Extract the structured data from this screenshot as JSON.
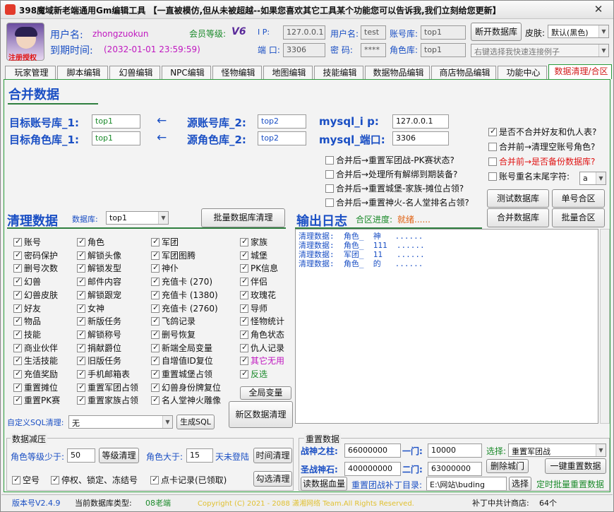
{
  "window": {
    "title": "398魔域新老端通用Gm编辑工具 【一直被模仿,但从未被超越--如果您喜欢其它工具某个功能您可以告诉我,我们立刻给您更新】",
    "close_icon": "close-icon"
  },
  "user": {
    "avatar_caption": "注册授权",
    "name_label": "用户名:",
    "name_value": "zhongzuokun",
    "expire_label": "到期时间:",
    "expire_value": "(2032-01-01 23:59:59)",
    "member_label": "会员等级:",
    "member_value": "V6"
  },
  "conn": {
    "ip_label": "I P:",
    "ip_value": "127.0.0.1",
    "user_label": "用户名:",
    "user_value": "test",
    "acct_db_label": "账号库:",
    "acct_db_value": "top1",
    "port_label": "端 口:",
    "port_value": "3306",
    "pwd_label": "密 码:",
    "pwd_value": "****",
    "role_db_label": "角色库:",
    "role_db_value": "top1",
    "disconnect_label": "断开数据库",
    "skin_label": "皮肤:",
    "skin_value": "默认(黑色)",
    "hint_value": "右键选择我快速连接例子"
  },
  "tabs": [
    "玩家管理",
    "脚本编辑",
    "幻兽编辑",
    "NPC编辑",
    "怪物编辑",
    "地图编辑",
    "技能编辑",
    "数据物品编辑",
    "商店物品编辑",
    "功能中心",
    "数据清理/合区"
  ],
  "merge": {
    "title": "合并数据",
    "target_acct_label": "目标账号库_1:",
    "target_acct_value": "top1",
    "target_role_label": "目标角色库_1:",
    "target_role_value": "top1",
    "arrow": "←",
    "src_acct_label": "源账号库_2:",
    "src_acct_value": "top2",
    "src_role_label": "源角色库_2:",
    "src_role_value": "top2",
    "mysql_ip_label": "mysql_i p:",
    "mysql_ip_value": "127.0.0.1",
    "mysql_port_label": "mysql_端口:",
    "mysql_port_value": "3306"
  },
  "merge_options": [
    {
      "label": "合并后→重置军团战-PK赛状态?",
      "checked": false
    },
    {
      "label": "合并后→处理所有解绑到期装备?",
      "checked": false
    },
    {
      "label": "合并后→重置城堡-家族-摊位占领?",
      "checked": false
    },
    {
      "label": "合并后→重置神火-名人堂排名占领?",
      "checked": false
    }
  ],
  "right_options": [
    {
      "label": "是否不合并好友和仇人表?",
      "checked": true,
      "color": "#111"
    },
    {
      "label": "合并前→清理空账号角色?",
      "checked": false,
      "color": "#111"
    },
    {
      "label": "合并前→是否备份数据库?",
      "checked": false,
      "color": "#e01414"
    },
    {
      "label": "账号重名末尾字符:",
      "checked": false,
      "color": "#111"
    }
  ],
  "suffix_value": "a",
  "merge_buttons": {
    "test_db": "测试数据库",
    "single": "单号合区",
    "merge_db": "合并数据库",
    "batch": "批量合区"
  },
  "clean": {
    "title": "清理数据",
    "db_label": "数据库:",
    "db_value": "top1",
    "batch_clean": "批量数据库清理"
  },
  "log": {
    "title": "输出日志",
    "progress_label": "合区进度:",
    "progress_value": "就绪......",
    "lines": [
      "清理数据:  角色_  神   ......",
      "清理数据:  角色_  111  ......",
      "清理数据:  军团_  11   ......",
      "清理数据:  角色_  的   ......"
    ]
  },
  "clean_col1": [
    {
      "label": "账号",
      "checked": true
    },
    {
      "label": "密码保护",
      "checked": true
    },
    {
      "label": "删号次数",
      "checked": true
    },
    {
      "label": "幻兽",
      "checked": true
    },
    {
      "label": "幻兽皮肤",
      "checked": true
    },
    {
      "label": "好友",
      "checked": true
    },
    {
      "label": "物品",
      "checked": true
    },
    {
      "label": "技能",
      "checked": true
    },
    {
      "label": "商业伙伴",
      "checked": true
    },
    {
      "label": "生活技能",
      "checked": true
    },
    {
      "label": "充值奖励",
      "checked": true
    },
    {
      "label": "重置摊位",
      "checked": true
    },
    {
      "label": "重置PK赛",
      "checked": true
    }
  ],
  "clean_col2": [
    {
      "label": "角色",
      "checked": true
    },
    {
      "label": "解锁头像",
      "checked": true
    },
    {
      "label": "解锁发型",
      "checked": true
    },
    {
      "label": "邮件内容",
      "checked": true
    },
    {
      "label": "解锁跟宠",
      "checked": true
    },
    {
      "label": "女神",
      "checked": true
    },
    {
      "label": "新版任务",
      "checked": true
    },
    {
      "label": "解锁称号",
      "checked": true
    },
    {
      "label": "捐献爵位",
      "checked": true
    },
    {
      "label": "旧版任务",
      "checked": true
    },
    {
      "label": "手机邮箱表",
      "checked": true
    },
    {
      "label": "重置军团占领",
      "checked": true
    },
    {
      "label": "重置家族占领",
      "checked": true
    }
  ],
  "clean_col3": [
    {
      "label": "军团",
      "checked": true
    },
    {
      "label": "军团图腾",
      "checked": true
    },
    {
      "label": "神仆",
      "checked": true
    },
    {
      "label": "充值卡 (270)",
      "checked": true
    },
    {
      "label": "充值卡 (1380)",
      "checked": true
    },
    {
      "label": "充值卡 (2760)",
      "checked": true
    },
    {
      "label": "飞鸽记录",
      "checked": true
    },
    {
      "label": "删号恢复",
      "checked": true
    },
    {
      "label": "新端全局变量",
      "checked": true
    },
    {
      "label": "自增值ID复位",
      "checked": true
    },
    {
      "label": "重置城堡占领",
      "checked": true
    },
    {
      "label": "幻兽身份牌复位",
      "checked": true
    },
    {
      "label": "名人堂神火雕像",
      "checked": true
    }
  ],
  "clean_col4": [
    {
      "label": "家族",
      "checked": true,
      "color": "#111"
    },
    {
      "label": "城堡",
      "checked": true,
      "color": "#111"
    },
    {
      "label": "PK信息",
      "checked": true,
      "color": "#111"
    },
    {
      "label": "伴侣",
      "checked": true,
      "color": "#111"
    },
    {
      "label": "玫瑰花",
      "checked": true,
      "color": "#111"
    },
    {
      "label": "导师",
      "checked": true,
      "color": "#111"
    },
    {
      "label": "怪物统计",
      "checked": true,
      "color": "#111"
    },
    {
      "label": "角色状态",
      "checked": true,
      "color": "#111"
    },
    {
      "label": "仇人记录",
      "checked": true,
      "color": "#111"
    },
    {
      "label": "其它无用",
      "checked": true,
      "color": "#c018c0"
    },
    {
      "label": "反选",
      "checked": true,
      "color": "#1a8a2a"
    }
  ],
  "global_var": "全局变量",
  "new_zone_clean": "新区数据清理",
  "custom_sql": {
    "label": "自定义SQL清理:",
    "value": "无",
    "btn": "生成SQL"
  },
  "reduce": {
    "title": "数据减压",
    "level_label": "角色等级少于:",
    "level_value": "50",
    "level_btn": "等级清理",
    "days_label": "角色大于:",
    "days_value": "15",
    "days_unit": "天未登陆",
    "time_btn": "时间清理",
    "empty_label": "空号",
    "empty_checked": true,
    "ban_label": "停权、锁定、冻结号",
    "ban_checked": true,
    "card_label": "点卡记录(已领取)",
    "card_checked": true,
    "select_btn": "勾选清理"
  },
  "reset": {
    "title": "重置数据",
    "war_label": "战神之柱:",
    "war_value": "66000000",
    "gate1_label": "一门:",
    "gate1_value": "10000",
    "select_label": "选择:",
    "select_value": "重置军团战",
    "holy_label": "圣战神石:",
    "holy_value": "400000000",
    "gate2_label": "二门:",
    "gate2_value": "63000000",
    "del_gate": "删除城门",
    "reset_all": "一键重置数据",
    "read_blood": "读数据血量",
    "patch_label": "重置团战补丁目录:",
    "patch_value": "E:\\网站\\buding",
    "choose": "选择",
    "timer_label": "定时批量重置数据"
  },
  "status": {
    "version": "版本号V2.4.9",
    "db_type": "当前数据库类型:",
    "db_type_value": "08老端",
    "copyright": "Copyright (C) 2021 - 2088 潇湘网络 Team.All Rights Reserved.",
    "patch_count": "补丁中共计商店:",
    "patch_count_value": "64个"
  }
}
